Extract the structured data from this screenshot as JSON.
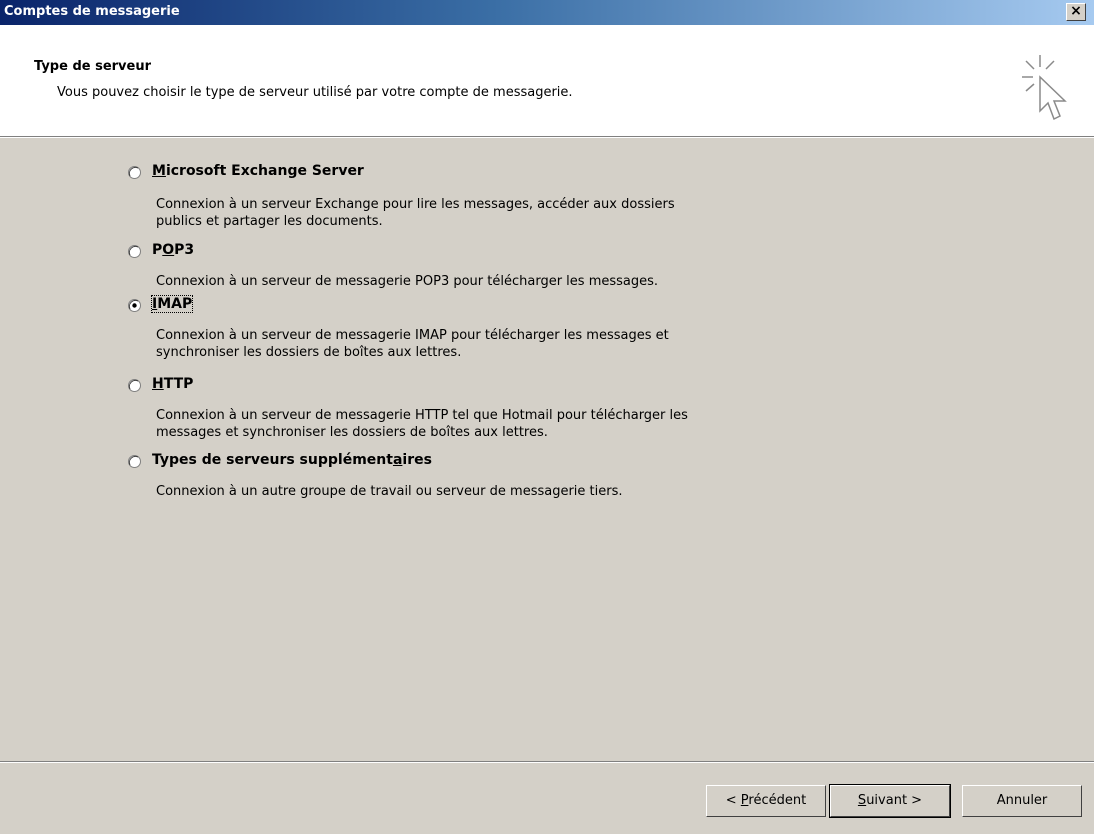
{
  "window": {
    "title": "Comptes de messagerie",
    "close_label": "×"
  },
  "header": {
    "title": "Type de serveur",
    "subtitle": "Vous pouvez choisir le type de serveur utilisé par votre compte de messagerie.",
    "icon": "cursor-sparkle-icon"
  },
  "options": [
    {
      "label_pre": "",
      "label_u": "M",
      "label_post": "icrosoft Exchange Server",
      "selected": false,
      "description_lines": [
        "Connexion à un serveur Exchange pour lire les messages, accéder aux dossiers",
        "publics et partager les documents."
      ]
    },
    {
      "label_pre": "P",
      "label_u": "O",
      "label_post": "P3",
      "selected": false,
      "description_lines": [
        "Connexion à un serveur de messagerie POP3 pour télécharger les messages."
      ]
    },
    {
      "label_pre": "",
      "label_u": "I",
      "label_post": "MAP",
      "selected": true,
      "description_lines": [
        "Connexion à un serveur de messagerie IMAP pour télécharger les messages et",
        "synchroniser les dossiers de boîtes aux lettres."
      ]
    },
    {
      "label_pre": "",
      "label_u": "H",
      "label_post": "TTP",
      "selected": false,
      "description_lines": [
        "Connexion à un serveur de messagerie HTTP tel que Hotmail pour télécharger les",
        "messages et synchroniser les dossiers de boîtes aux lettres."
      ]
    },
    {
      "label_pre": "Types de serveurs supplément",
      "label_u": "a",
      "label_post": "ires",
      "selected": false,
      "description_lines": [
        "Connexion à un autre groupe de travail ou serveur de messagerie tiers."
      ]
    }
  ],
  "buttons": {
    "back": {
      "pre": "< ",
      "u": "P",
      "post": "récédent"
    },
    "next": {
      "pre": "",
      "u": "S",
      "post": "uivant >"
    },
    "cancel": {
      "label": "Annuler"
    }
  }
}
